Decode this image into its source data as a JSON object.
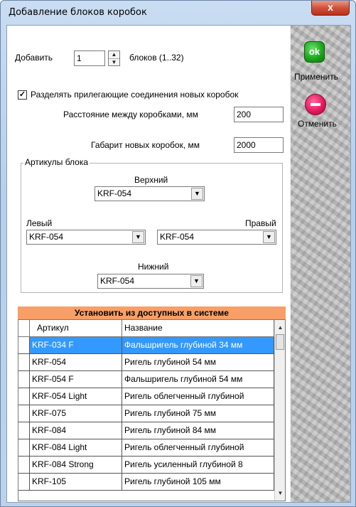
{
  "window": {
    "title": "Добавление блоков коробок",
    "close_glyph": "x"
  },
  "add": {
    "label": "Добавить",
    "value": "1",
    "suffix": "блоков (1..32)"
  },
  "separate": {
    "checked": true,
    "label": "Разделять прилегающие соединения новых коробок"
  },
  "distance": {
    "label": "Расстояние между коробками, мм",
    "value": "200"
  },
  "gabarit": {
    "label": "Габарит новых коробок, мм",
    "value": "2000"
  },
  "articles": {
    "group_title": "Артикулы блока",
    "top": {
      "label": "Верхний",
      "value": "KRF-054"
    },
    "left": {
      "label": "Левый",
      "value": "KRF-054"
    },
    "right": {
      "label": "Правый",
      "value": "KRF-054"
    },
    "bottom": {
      "label": "Нижний",
      "value": "KRF-054"
    }
  },
  "install_header": "Установить из доступных в системе",
  "table": {
    "columns": [
      "Артикул",
      "Название"
    ],
    "rows": [
      {
        "article": "KRF-034 F",
        "name": "Фальшригель глубиной 34 мм",
        "selected": true
      },
      {
        "article": "KRF-054",
        "name": "Ригель глубиной 54 мм"
      },
      {
        "article": "KRF-054 F",
        "name": "Фальшригель глубиной 54 мм"
      },
      {
        "article": "KRF-054 Light",
        "name": "Ригель облегченный глубиной"
      },
      {
        "article": "KRF-075",
        "name": "Ригель глубиной 75 мм"
      },
      {
        "article": "KRF-084",
        "name": "Ригель глубиной 84 мм"
      },
      {
        "article": "KRF-084 Light",
        "name": "Ригель облегченный глубиной"
      },
      {
        "article": "KRF-084 Strong",
        "name": "Ригель усиленный глубиной 8"
      },
      {
        "article": "KRF-105",
        "name": "Ригель глубиной 105 мм"
      }
    ]
  },
  "buttons": {
    "apply": {
      "label": "Применить",
      "icon_text": "ok",
      "icon": "ok-check-icon"
    },
    "cancel": {
      "label": "Отменить",
      "icon": "no-entry-icon"
    }
  },
  "colors": {
    "accent_orange": "#f79f66",
    "selection_blue": "#3399ff",
    "ok_green": "#1aa41a",
    "cancel_red": "#e0145a"
  }
}
